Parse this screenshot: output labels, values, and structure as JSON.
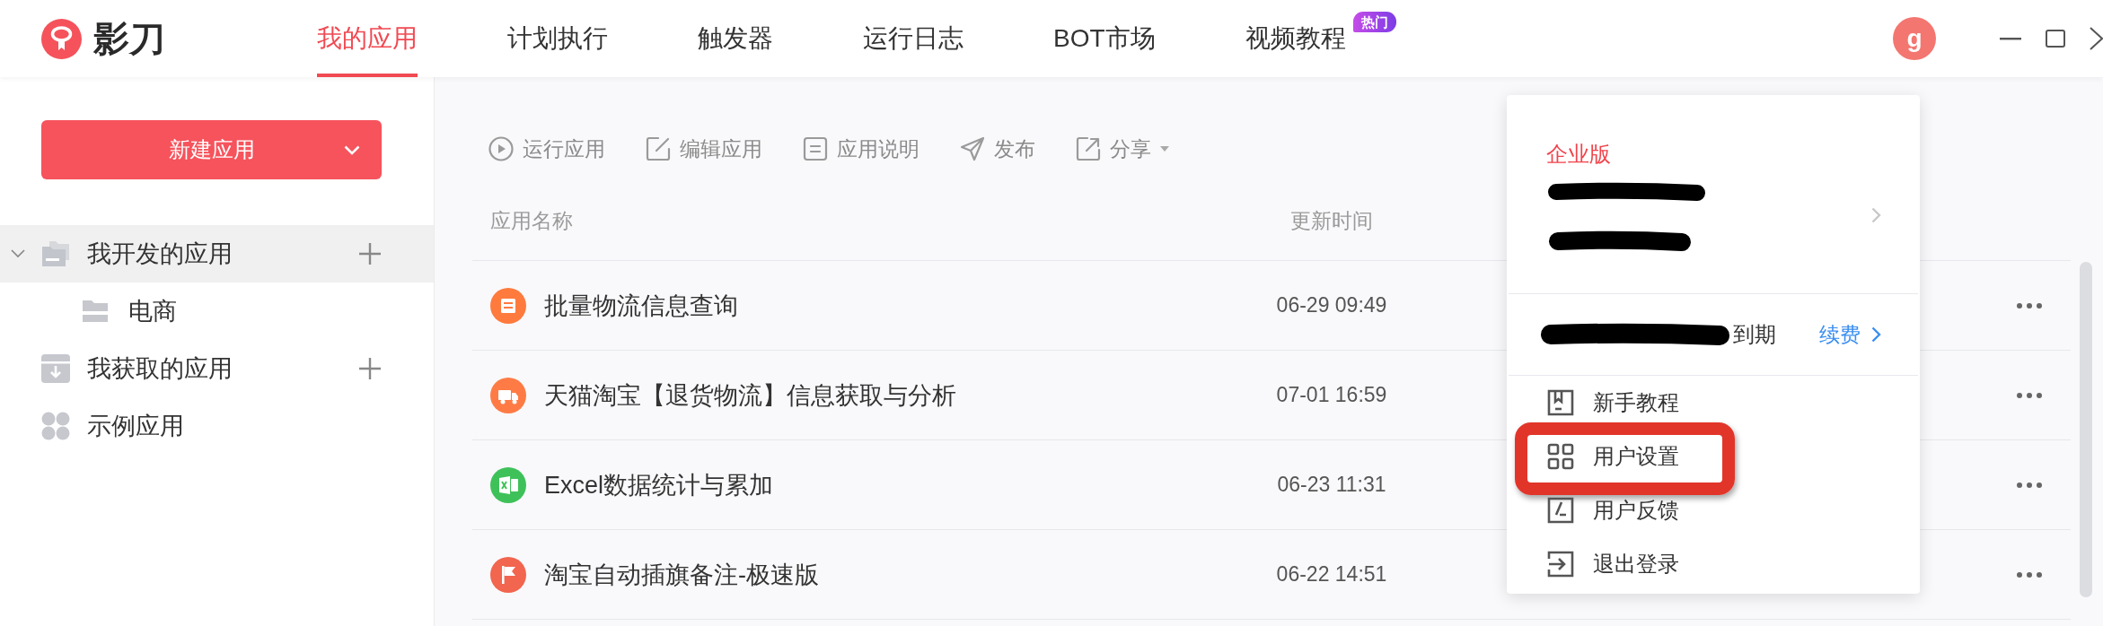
{
  "app": {
    "name": "影刀"
  },
  "nav": [
    {
      "label": "我的应用",
      "selected": true
    },
    {
      "label": "计划执行",
      "selected": false
    },
    {
      "label": "触发器",
      "selected": false
    },
    {
      "label": "运行日志",
      "selected": false
    },
    {
      "label": "BOT市场",
      "selected": false
    },
    {
      "label": "视频教程",
      "selected": false,
      "badge": "热门"
    }
  ],
  "avatar": {
    "initial": "g"
  },
  "sidebar": {
    "new_button": "新建应用",
    "tree": [
      {
        "label": "我开发的应用",
        "selected": true,
        "expanded": true,
        "can_add": true,
        "children": [
          {
            "label": "电商",
            "selected": false
          }
        ]
      },
      {
        "label": "我获取的应用",
        "selected": false,
        "can_add": true
      },
      {
        "label": "示例应用",
        "selected": false,
        "can_add": false
      }
    ]
  },
  "toolbar": [
    {
      "label": "运行应用",
      "has_menu": false
    },
    {
      "label": "编辑应用",
      "has_menu": false
    },
    {
      "label": "应用说明",
      "has_menu": false
    },
    {
      "label": "发布",
      "has_menu": false
    },
    {
      "label": "分享",
      "has_menu": true
    }
  ],
  "table": {
    "columns": [
      "应用名称",
      "更新时间"
    ],
    "rows": [
      {
        "name": "批量物流信息查询",
        "updated": "06-29 09:49",
        "color": "#ff7a3d"
      },
      {
        "name": "天猫淘宝【退货物流】信息获取与分析",
        "updated": "07-01 16:59",
        "color": "#ff7b45"
      },
      {
        "name": "Excel数据统计与累加",
        "updated": "06-23 11:31",
        "color": "#3fc15a"
      },
      {
        "name": "淘宝自动插旗备注-极速版",
        "updated": "06-22 14:51",
        "color": "#f2654f"
      }
    ]
  },
  "account_menu": {
    "edition": "企业版",
    "expiry_suffix": "到期",
    "renew_link": "续费",
    "items": [
      {
        "label": "新手教程",
        "highlighted": false
      },
      {
        "label": "用户设置",
        "highlighted": true
      },
      {
        "label": "用户反馈",
        "highlighted": false
      },
      {
        "label": "退出登录",
        "highlighted": false
      }
    ]
  }
}
